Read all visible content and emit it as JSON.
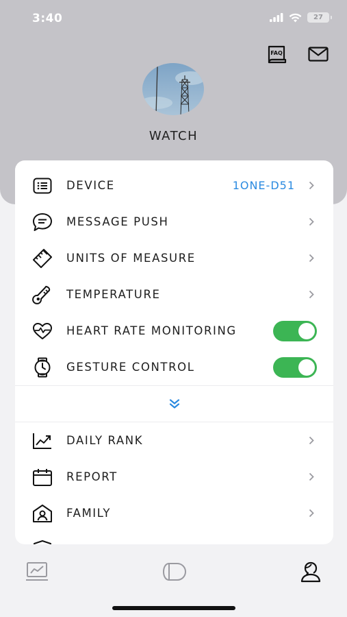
{
  "status_bar": {
    "time": "3:40",
    "battery": "27"
  },
  "header": {
    "device_title": "WATCH",
    "faq_icon_label": "FAQ"
  },
  "menu_top": [
    {
      "name": "device",
      "label": "DEVICE",
      "value": "1ONE-D51",
      "control": "chevron",
      "icon": "list-icon"
    },
    {
      "name": "message-push",
      "label": "MESSAGE PUSH",
      "control": "chevron",
      "icon": "chat-bubble-icon"
    },
    {
      "name": "units-of-measure",
      "label": "UNITS OF MEASURE",
      "control": "chevron",
      "icon": "ruler-icon"
    },
    {
      "name": "temperature",
      "label": "TEMPERATURE",
      "control": "chevron",
      "icon": "thermometer-icon"
    },
    {
      "name": "heart-rate-monitoring",
      "label": "HEART RATE MONITORING",
      "control": "toggle",
      "on": true,
      "icon": "heart-pulse-icon"
    },
    {
      "name": "gesture-control",
      "label": "GESTURE CONTROL",
      "control": "toggle",
      "on": true,
      "icon": "watch-icon"
    }
  ],
  "menu_bottom": [
    {
      "name": "daily-rank",
      "label": "DAILY RANK",
      "control": "chevron",
      "icon": "chart-trend-icon"
    },
    {
      "name": "report",
      "label": "REPORT",
      "control": "chevron",
      "icon": "calendar-icon"
    },
    {
      "name": "family",
      "label": "FAMILY",
      "control": "chevron",
      "icon": "home-person-icon"
    }
  ],
  "tabs": [
    {
      "name": "activity",
      "icon": "chart-screen-icon"
    },
    {
      "name": "device",
      "icon": "watch-icon"
    },
    {
      "name": "profile",
      "icon": "person-icon"
    }
  ],
  "colors": {
    "accent_blue": "#2a8ae0",
    "toggle_green": "#3cb554",
    "header_gray": "#c4c3c8"
  }
}
